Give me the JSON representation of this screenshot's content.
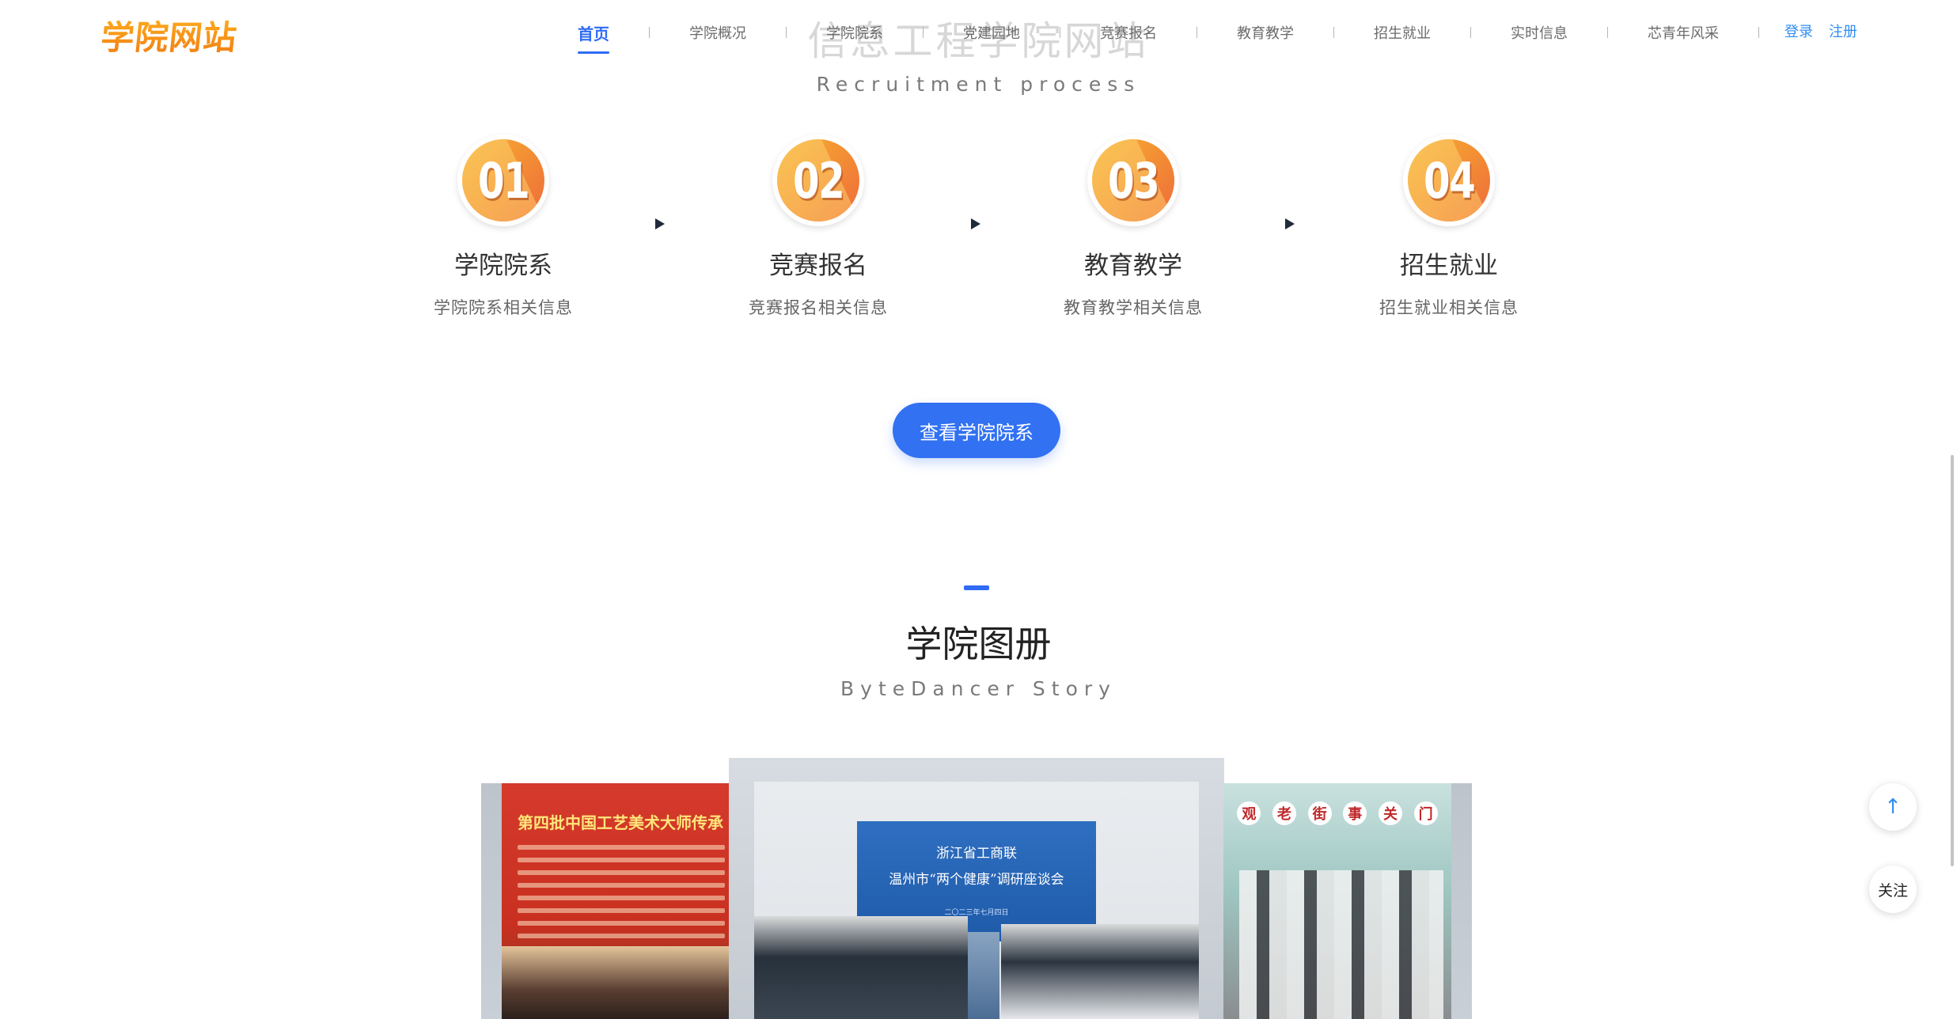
{
  "header": {
    "logo": "学院网站",
    "ghost_title": "信息工程学院网站",
    "nav": [
      {
        "label": "首页",
        "active": true
      },
      {
        "label": "学院概况"
      },
      {
        "label": "学院院系"
      },
      {
        "label": "党建园地"
      },
      {
        "label": "竞赛报名"
      },
      {
        "label": "教育教学"
      },
      {
        "label": "招生就业"
      },
      {
        "label": "实时信息"
      },
      {
        "label": "芯青年风采"
      }
    ],
    "login": "登录",
    "register": "注册"
  },
  "process": {
    "subtitle_en": "Recruitment process",
    "steps": [
      {
        "num": "01",
        "title": "学院院系",
        "desc": "学院院系相关信息"
      },
      {
        "num": "02",
        "title": "竞赛报名",
        "desc": "竞赛报名相关信息"
      },
      {
        "num": "03",
        "title": "教育教学",
        "desc": "教育教学相关信息"
      },
      {
        "num": "04",
        "title": "招生就业",
        "desc": "招生就业相关信息"
      }
    ],
    "cta": "查看学院院系"
  },
  "gallery": {
    "title": "学院图册",
    "subtitle_en": "ByteDancer Story",
    "left_banner": "第四批中国工艺美术大师传承",
    "center_screen_line1": "浙江省工商联",
    "center_screen_line2": "温州市“两个健康”调研座谈会",
    "center_screen_line3": "二〇二三年七月四日",
    "right_sign": [
      "观",
      "老",
      "街",
      "事",
      "关",
      "门"
    ]
  },
  "floating": {
    "top_icon": "arrow-up-icon",
    "top_glyph": "↑",
    "follow": "关注"
  },
  "colors": {
    "accent": "#2f6bf5",
    "cta": "#3171f2",
    "badge_orange": "#f39234",
    "logo_orange": "#f59a17"
  }
}
